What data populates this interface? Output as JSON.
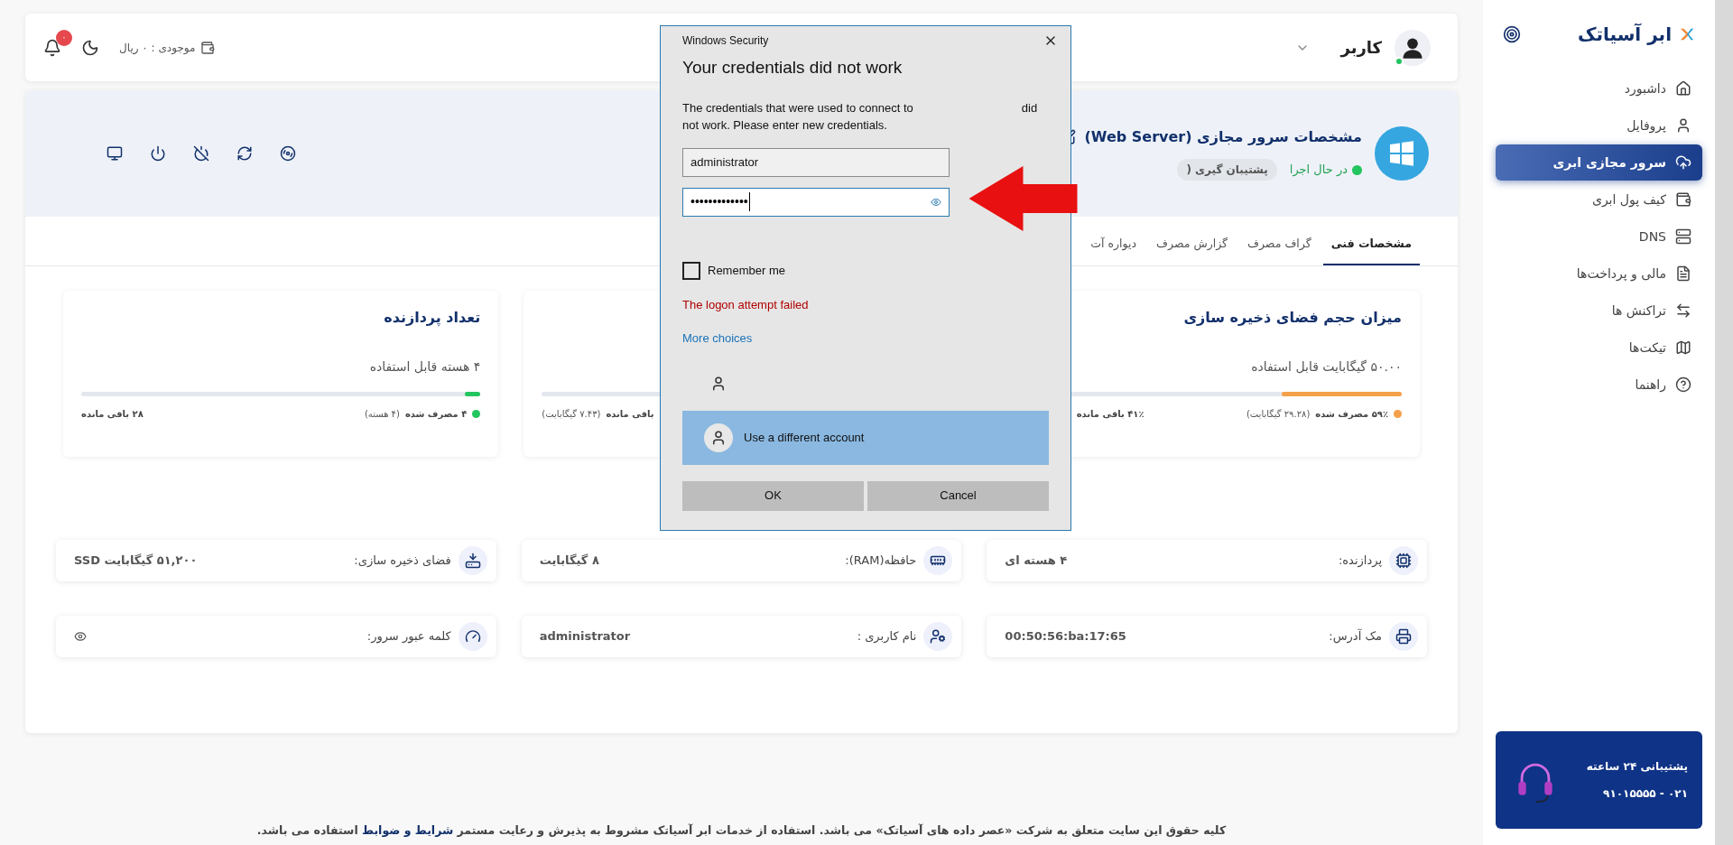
{
  "topbar": {
    "user_name": "کاربر",
    "online": true,
    "balance": "موجودی : ۰ ریال",
    "notification_count": "۰"
  },
  "server": {
    "title": "مشخصات سرور مجازی (Web Server)",
    "status": "در حال اجرا",
    "backup_badge": "پشتیبان گیری ("
  },
  "tabs": [
    {
      "label": "مشخصات فنی",
      "selected": true
    },
    {
      "label": "گراف مصرف",
      "selected": false
    },
    {
      "label": "گزارش مصرف",
      "selected": false
    },
    {
      "label": "دیواره آت",
      "selected": false
    }
  ],
  "usage_cards": [
    {
      "title": "میزان حجم فضای ذخیره سازی",
      "available": "۵۰.۰۰ گیگابایت قابل استفاده",
      "level": 0.3,
      "color": "#f5a04a",
      "used": "۵۹٪ مصرف شده",
      "used_detail": "(۲۹.۲۸ گیگابایت)",
      "remaining": "۴۱٪ باقی مانده"
    },
    {
      "remaining": "باقی مانده",
      "remaining_detail": "(۷.۴۳ گیگابایت)"
    },
    {
      "title": "تعداد پردازنده",
      "available": "۴ هسته قابل استفاده",
      "level": 0.04,
      "color": "#22c55e",
      "used": "۴ مصرف شده",
      "used_detail": "(۴ هسته)",
      "remaining": "۲۸ باقی مانده"
    }
  ],
  "specs": [
    {
      "kind": "text",
      "label": "پردازنده:",
      "value": "۴ هسته ای"
    },
    {
      "kind": "text",
      "label": "حافظه(RAM):",
      "value": "۸ گیگابایت"
    },
    {
      "kind": "text",
      "label": "فضای ذخیره سازی:",
      "value": "۵۱,۲۰۰ گیگابایت SSD"
    },
    {
      "kind": "text",
      "label": "مک آدرس:",
      "value": "00:50:56:ba:17:65"
    },
    {
      "kind": "text",
      "label": "نام کاربری :",
      "value": "administrator"
    },
    {
      "kind": "password",
      "label": "کلمه عبور سرور:"
    }
  ],
  "footer": {
    "text_before": "کلیه حقوق این سایت متعلق به شرکت **«عصر داده های آسیاتک»** می باشد. استفاده از خدمات ابر آسیاتک مشروط به پذیرش و رعایت مستمر",
    "link": "شرایط و ضوابط",
    "text_after": "استفاده می باشد."
  },
  "sidebar": {
    "brand": "ابر آسیاتک",
    "items": [
      {
        "label": "داشبورد",
        "selected": false
      },
      {
        "label": "پروفایل",
        "selected": false
      },
      {
        "label": "سرور مجازی ابری",
        "selected": true
      },
      {
        "label": "کیف پول ابری",
        "selected": false
      },
      {
        "label": "DNS",
        "selected": false
      },
      {
        "label": "مالی و پرداخت‌ها",
        "selected": false
      },
      {
        "label": "تراکنش ها",
        "selected": false
      },
      {
        "label": "تیکت‌ها",
        "selected": false
      },
      {
        "label": "راهنما",
        "selected": false
      }
    ],
    "support": {
      "title": "پشتیبانی ۲۴ ساعته",
      "phone": "۰۲۱ - ۹۱۰۱۵۵۵۵"
    }
  },
  "dialog": {
    "app": "Windows Security",
    "heading": "Your credentials did not work",
    "message_start": "The credentials that were used to connect to",
    "message_end": "did not work. Please enter new credentials.",
    "username": "administrator",
    "password": "•••••••••••••",
    "remember_me": {
      "label": "Remember me",
      "checked": false
    },
    "error": "The logon attempt failed",
    "more_choices": "More choices",
    "accounts": [
      {
        "kind": "blank",
        "selected": false
      },
      {
        "kind": "other",
        "label": "Use a different account",
        "selected": true
      }
    ],
    "ok_button": "OK",
    "cancel_button": "Cancel"
  }
}
